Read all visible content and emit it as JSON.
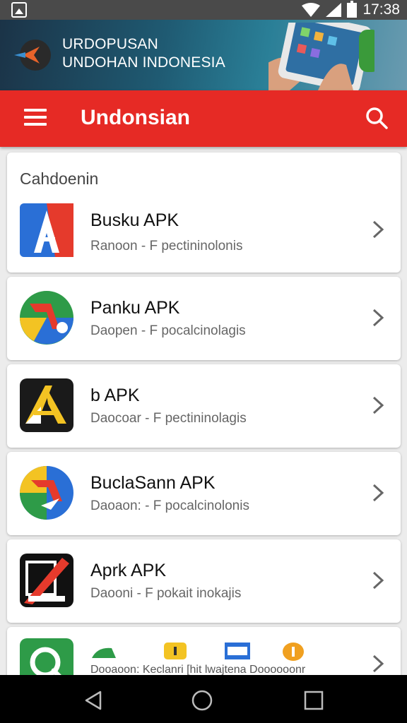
{
  "status_bar": {
    "time": "17:38"
  },
  "banner": {
    "line1": "URDOPUSAN",
    "line2": "UNDOHAN INDONESIA"
  },
  "app_bar": {
    "title": "Undonsian"
  },
  "section": {
    "title": "Cahdoenin"
  },
  "apps": [
    {
      "name": "Busku APK",
      "desc": "Ranoon - F pectininolonis",
      "icon": "red-blue-a-icon"
    },
    {
      "name": "Panku APK",
      "desc": "Daopen - F pocalcinolagis",
      "icon": "green-circle-arrow-icon"
    },
    {
      "name": "b APK",
      "desc": "Daocoar - F pectininolagis",
      "icon": "black-yellow-a-icon"
    },
    {
      "name": "BuclaSann APK",
      "desc": "Daoaon: - F pocalcinolonis",
      "icon": "blue-circle-arrow-icon"
    },
    {
      "name": "Aprk APK",
      "desc": "Daooni - F pokait inokajis",
      "icon": "black-red-logo-icon"
    }
  ],
  "last_row": {
    "text": "Dooaoon: Keclanri [hit lwajtena Doooooonr"
  },
  "colors": {
    "app_bar": "#e62a25",
    "status_bar": "#4a4a4a",
    "nav_bar": "#000000"
  }
}
